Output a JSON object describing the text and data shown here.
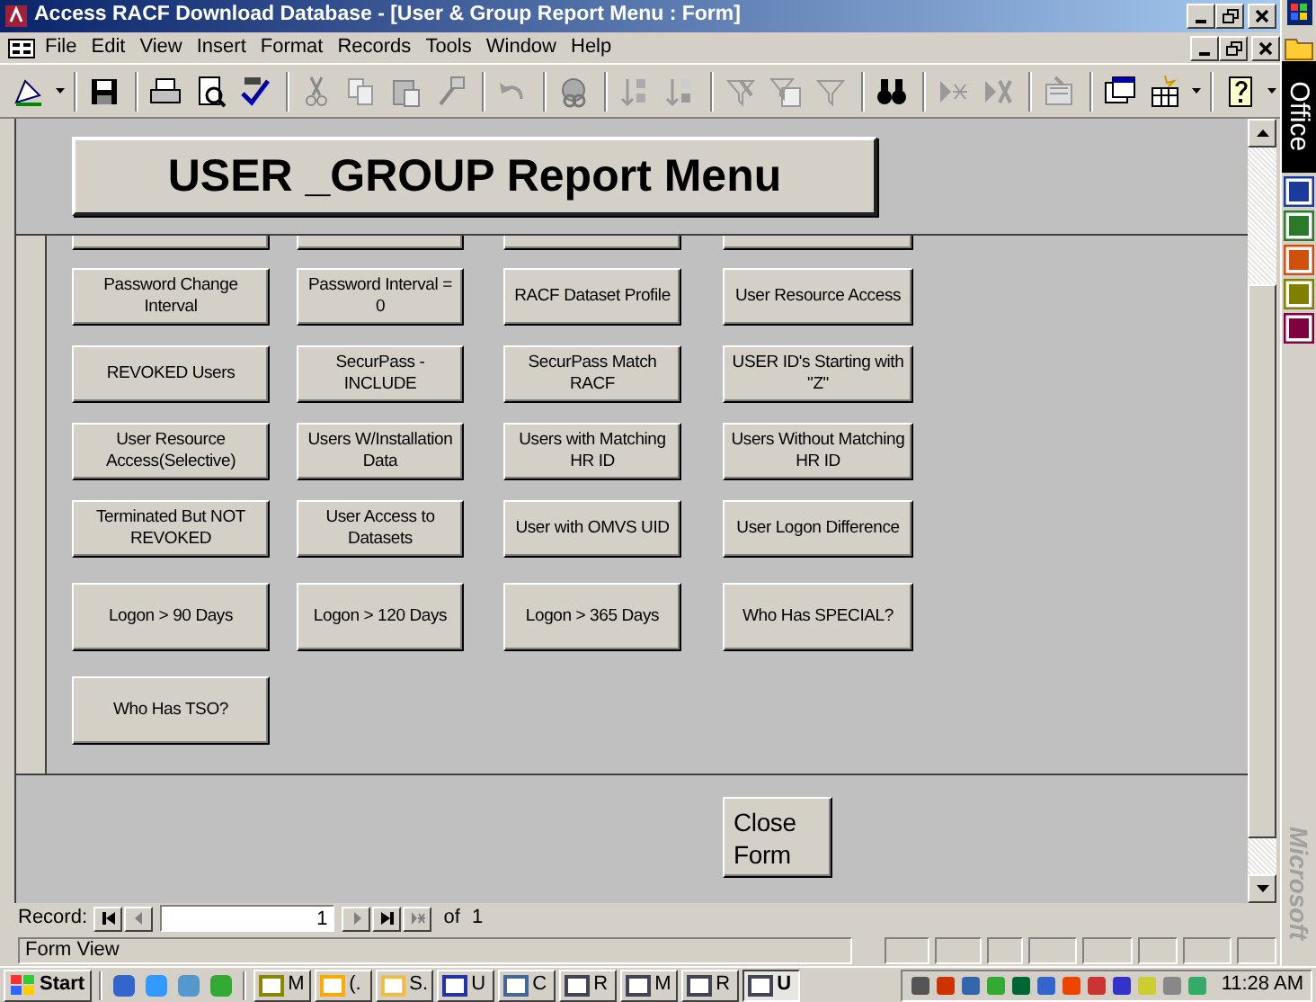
{
  "window": {
    "title": "Access RACF Download Database - [User & Group Report Menu : Form]"
  },
  "menu": [
    "File",
    "Edit",
    "View",
    "Insert",
    "Format",
    "Records",
    "Tools",
    "Window",
    "Help"
  ],
  "form": {
    "header_title": "USER _GROUP Report Menu",
    "button_rows": [
      [
        "Password Change Interval",
        "Password Interval = 0",
        "RACF Dataset Profile",
        "User Resource Access"
      ],
      [
        "REVOKED Users",
        "SecurPass - INCLUDE",
        "SecurPass Match RACF",
        "USER ID's Starting with \"Z\""
      ],
      [
        "User Resource Access(Selective)",
        "Users W/Installation Data",
        "Users with Matching HR ID",
        "Users Without Matching HR ID"
      ],
      [
        "Terminated But NOT REVOKED",
        "User Access to Datasets",
        "User with OMVS UID",
        "User Logon Difference"
      ],
      [
        "Logon > 90 Days",
        "Logon > 120 Days",
        "Logon > 365 Days",
        "Who Has SPECIAL?"
      ],
      [
        "Who Has TSO?"
      ]
    ],
    "close_button": "Close Form"
  },
  "record_nav": {
    "label": "Record:",
    "value": "1",
    "of": "of",
    "total": "1"
  },
  "status_bar": "Form View",
  "office_bar": {
    "title": "Office",
    "brand": "Microsoft"
  },
  "taskbar": {
    "start": "Start",
    "tasks": [
      {
        "label": "M",
        "selected": false
      },
      {
        "label": "(.",
        "selected": false
      },
      {
        "label": "S.",
        "selected": false
      },
      {
        "label": "U",
        "selected": false
      },
      {
        "label": "C",
        "selected": false
      },
      {
        "label": "R",
        "selected": false
      },
      {
        "label": "M",
        "selected": false
      },
      {
        "label": "R",
        "selected": false
      },
      {
        "label": "U",
        "selected": true
      }
    ],
    "clock": "11:28 AM"
  }
}
